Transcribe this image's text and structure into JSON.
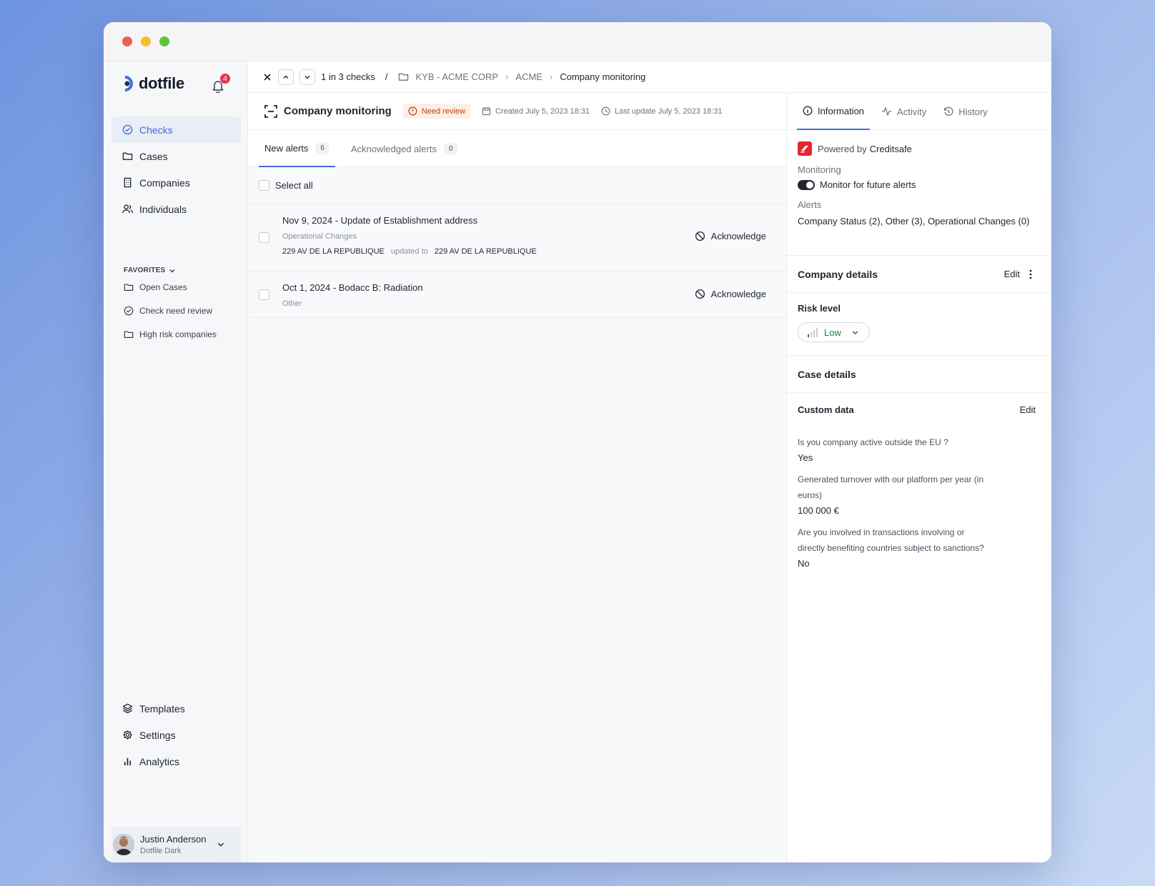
{
  "app": {
    "brand": "dotfile",
    "notifications_count": "4"
  },
  "sidebar": {
    "nav": [
      {
        "label": "Checks",
        "icon": "check-circle-icon"
      },
      {
        "label": "Cases",
        "icon": "folder-icon"
      },
      {
        "label": "Companies",
        "icon": "building-icon"
      },
      {
        "label": "Individuals",
        "icon": "users-icon"
      }
    ],
    "favorites_title": "FAVORITES",
    "favorites": [
      {
        "label": "Open Cases",
        "icon": "folder-icon"
      },
      {
        "label": "Check need review",
        "icon": "check-circle-icon"
      },
      {
        "label": "High risk companies",
        "icon": "folder-icon"
      }
    ],
    "bottom": [
      {
        "label": "Templates",
        "icon": "layers-icon"
      },
      {
        "label": "Settings",
        "icon": "gear-icon"
      },
      {
        "label": "Analytics",
        "icon": "bar-chart-icon"
      }
    ],
    "user": {
      "name": "Justin Anderson",
      "org": "Dotfile Dark"
    }
  },
  "topbar": {
    "position": "1 in 3 checks",
    "separator": "/",
    "breadcrumb": [
      "KYB - ACME CORP",
      "ACME",
      "Company monitoring"
    ]
  },
  "check": {
    "title": "Company monitoring",
    "status": "Need review",
    "created": "Created July 5, 2023 18:31",
    "updated": "Last update July 5, 2023 18:31"
  },
  "tabs": [
    {
      "label": "New alerts",
      "count": "6"
    },
    {
      "label": "Acknowledged alerts",
      "count": "0"
    }
  ],
  "select_all": "Select all",
  "alerts": [
    {
      "title": "Nov 9, 2024 - Update of Establishment address",
      "category": "Operational Changes",
      "from": "229 AV DE LA REPUBLIQUE",
      "updated_to": "updated to",
      "to": "229 AV DE LA REPUBLIQUE",
      "action": "Acknowledge"
    },
    {
      "title": "Oct 1, 2024 - Bodacc B: Radiation",
      "category": "Other",
      "action": "Acknowledge"
    }
  ],
  "panel": {
    "tabs": [
      "Information",
      "Activity",
      "History"
    ],
    "powered_prefix": "Powered by",
    "powered_name": "Creditsafe",
    "monitoring_label": "Monitoring",
    "monitoring_value": "Monitor for future alerts",
    "alerts_label": "Alerts",
    "alerts_value": "Company Status (2), Other (3), Operational Changes (0)",
    "company_details": "Company details",
    "edit": "Edit",
    "risk_label": "Risk level",
    "risk_value": "Low",
    "case_details": "Case details",
    "custom_data": "Custom data",
    "questions": [
      {
        "q": "Is you company active outside the EU ?",
        "a": "Yes"
      },
      {
        "q": "Generated turnover with our platform per year (in euros)",
        "a": "100 000 €"
      },
      {
        "q": "Are you involved in transactions involving or directly benefiting countries subject to sanctions?",
        "a": "No"
      }
    ]
  },
  "colors": {
    "accent": "#3f6fd8",
    "review_bg": "#fdeee6",
    "review_text": "#c2410c",
    "risk_low": "#15803d",
    "creditsafe": "#e3262f"
  }
}
